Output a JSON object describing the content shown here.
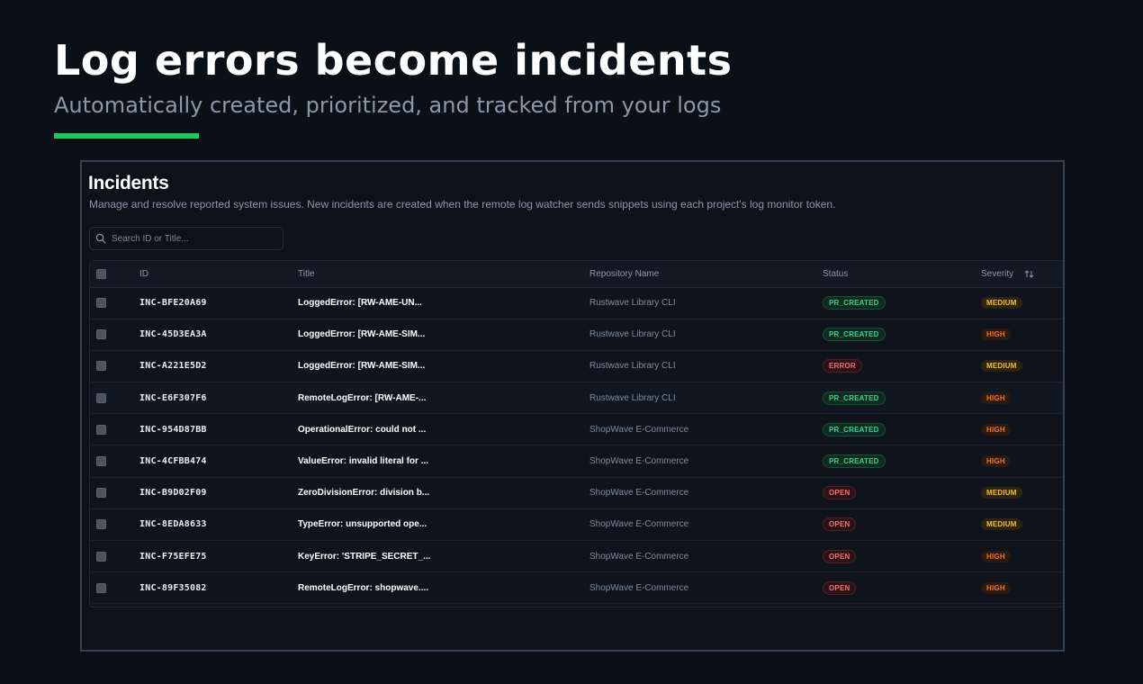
{
  "hero": {
    "title": "Log errors become incidents",
    "subtitle": "Automatically created, prioritized, and tracked from your logs",
    "accent_color": "#22c55e"
  },
  "panel": {
    "title": "Incidents",
    "description": "Manage and resolve reported system issues. New incidents are created when the remote log watcher sends snippets using each project's log monitor token."
  },
  "search": {
    "placeholder": "Search ID or Title...",
    "value": "",
    "icon": "search-icon"
  },
  "table": {
    "headers": {
      "id": "ID",
      "title": "Title",
      "repo": "Repository Name",
      "status": "Status",
      "severity": "Severity"
    },
    "rows": [
      {
        "id": "INC-BFE20A69",
        "title": "LoggedError: [RW-AME-UN...",
        "repo": "Rustwave Library CLI",
        "status": "PR_CREATED",
        "severity": "MEDIUM"
      },
      {
        "id": "INC-45D3EA3A",
        "title": "LoggedError: [RW-AME-SIM...",
        "repo": "Rustwave Library CLI",
        "status": "PR_CREATED",
        "severity": "HIGH"
      },
      {
        "id": "INC-A221E5D2",
        "title": "LoggedError: [RW-AME-SIM...",
        "repo": "Rustwave Library CLI",
        "status": "ERROR",
        "severity": "MEDIUM"
      },
      {
        "id": "INC-E6F307F6",
        "title": "RemoteLogError: [RW-AME-...",
        "repo": "Rustwave Library CLI",
        "status": "PR_CREATED",
        "severity": "HIGH"
      },
      {
        "id": "INC-954D87BB",
        "title": "OperationalError: could not ...",
        "repo": "ShopWave E-Commerce",
        "status": "PR_CREATED",
        "severity": "HIGH"
      },
      {
        "id": "INC-4CFBB474",
        "title": "ValueError: invalid literal for ...",
        "repo": "ShopWave E-Commerce",
        "status": "PR_CREATED",
        "severity": "HIGH"
      },
      {
        "id": "INC-B9D02F09",
        "title": "ZeroDivisionError: division b...",
        "repo": "ShopWave E-Commerce",
        "status": "OPEN",
        "severity": "MEDIUM"
      },
      {
        "id": "INC-8EDA8633",
        "title": "TypeError: unsupported ope...",
        "repo": "ShopWave E-Commerce",
        "status": "OPEN",
        "severity": "MEDIUM"
      },
      {
        "id": "INC-F75EFE75",
        "title": "KeyError: 'STRIPE_SECRET_...",
        "repo": "ShopWave E-Commerce",
        "status": "OPEN",
        "severity": "HIGH"
      },
      {
        "id": "INC-89F35082",
        "title": "RemoteLogError: shopwave....",
        "repo": "ShopWave E-Commerce",
        "status": "OPEN",
        "severity": "HIGH"
      }
    ]
  },
  "colors": {
    "background": "#0b0f16",
    "status_pr_created": "#34d399",
    "status_error": "#f87171",
    "status_open": "#f87171",
    "severity_medium": "#fbbf24",
    "severity_high": "#f97316"
  }
}
